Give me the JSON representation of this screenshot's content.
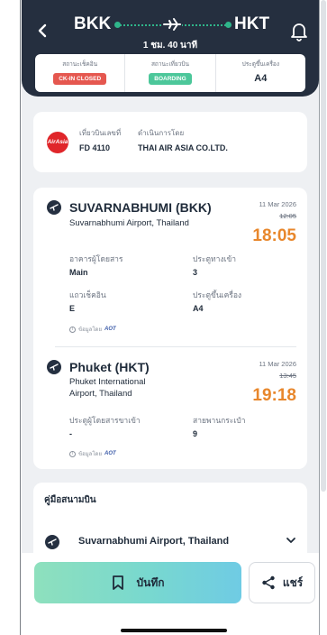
{
  "header": {
    "from_code": "BKK",
    "to_code": "HKT",
    "duration": "1 ชม. 40 นาที",
    "status": {
      "checkin_label": "สถานะเช็คอิน",
      "checkin_value": "CK-IN CLOSED",
      "flight_label": "สถานะเที่ยวบิน",
      "flight_value": "BOARDING",
      "gate_label": "ประตูขึ้นเครื่อง",
      "gate_value": "A4"
    }
  },
  "airline": {
    "logo_text": "AirAsia",
    "flight_no_label": "เที่ยวบินเลขที่",
    "flight_no": "FD 4110",
    "operator_label": "ดำเนินการโดย",
    "operator": "THAI AIR ASIA CO.LTD."
  },
  "departure": {
    "name": "SUVARNABHUMI (BKK)",
    "sub": "Suvarnabhumi Airport, Thailand",
    "date": "11 Mar 2026",
    "old_time": "12:05",
    "new_time": "18:05",
    "terminal_label": "อาคารผู้โดยสาร",
    "terminal": "Main",
    "gate_label": "ประตูทางเข้า",
    "gate": "3",
    "checkin_row_label": "แถวเช็คอิน",
    "checkin_row": "E",
    "boarding_gate_label": "ประตูขึ้นเครื่อง",
    "boarding_gate": "A4",
    "source_label": "ข้อมูลโดย",
    "source_brand": "AOT"
  },
  "arrival": {
    "name": "Phuket (HKT)",
    "sub_line1": "Phuket International",
    "sub_line2": "Airport, Thailand",
    "date": "11 Mar 2026",
    "old_time": "13:45",
    "new_time": "19:18",
    "arrival_gate_label": "ประตูผู้โดยสารขาเข้า",
    "arrival_gate": "-",
    "belt_label": "สายพานกระเป๋า",
    "belt": "9",
    "source_label": "ข้อมูลโดย",
    "source_brand": "AOT"
  },
  "guide": {
    "title": "คู่มือสนามบิน",
    "item": "Suvarnabhumi Airport, Thailand"
  },
  "actions": {
    "save_label": "บันทึก",
    "share_label": "แชร์"
  },
  "colors": {
    "header_bg": "#252f3f",
    "accent_orange": "#e8872c",
    "closed_red": "#e5574f",
    "boarding_green": "#4cc79a"
  }
}
